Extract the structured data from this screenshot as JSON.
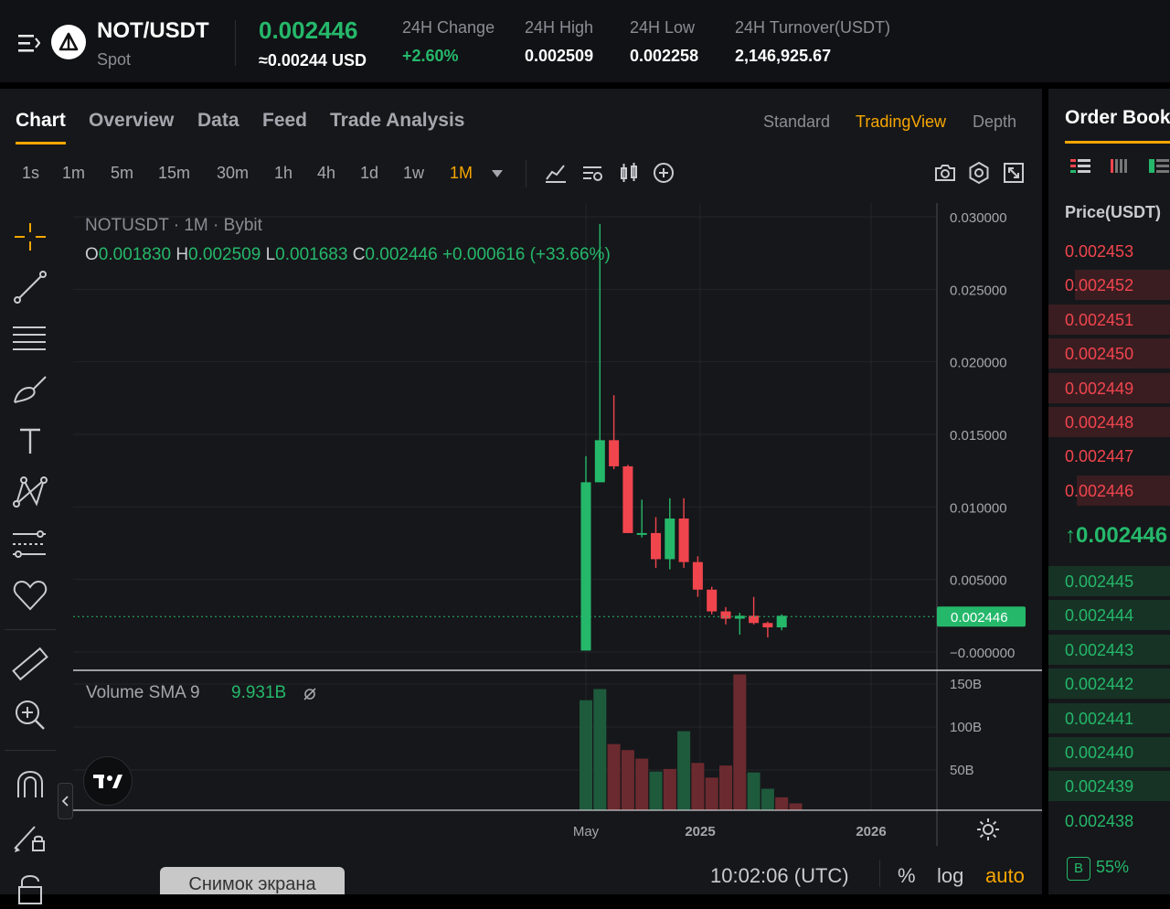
{
  "header": {
    "pair": "NOT/USDT",
    "market": "Spot",
    "last_price": "0.002446",
    "usd_price": "≈0.00244 USD",
    "stats": [
      {
        "label": "24H Change",
        "value": "+2.60%",
        "positive": true
      },
      {
        "label": "24H High",
        "value": "0.002509"
      },
      {
        "label": "24H Low",
        "value": "0.002258"
      },
      {
        "label": "24H Turnover(USDT)",
        "value": "2,146,925.67"
      }
    ]
  },
  "tabs": [
    "Chart",
    "Overview",
    "Data",
    "Feed",
    "Trade Analysis"
  ],
  "active_tab": "Chart",
  "chart_views": [
    "Standard",
    "TradingView",
    "Depth"
  ],
  "active_view": "TradingView",
  "timeframes": [
    "1s",
    "1m",
    "5m",
    "15m",
    "30m",
    "1h",
    "4h",
    "1d",
    "1w",
    "1M"
  ],
  "active_timeframe": "1M",
  "toolbar_icons": [
    "indicators-icon",
    "chart-settings-icon",
    "candle-type-icon",
    "add-compare-icon"
  ],
  "right_icons": [
    "camera-icon",
    "settings-icon",
    "fullscreen-icon"
  ],
  "left_tools": [
    "crosshair-icon",
    "trend-line-icon",
    "fib-retracement-icon",
    "brush-icon",
    "text-icon",
    "pattern-icon",
    "forecast-icon",
    "heart-icon",
    "ruler-icon",
    "zoom-in-icon",
    "magnet-icon",
    "lock-drawing-icon",
    "lock-icon"
  ],
  "legend": {
    "symbol_line": "NOTUSDT · 1M · Bybit",
    "o_label": "O",
    "o": "0.001830",
    "h_label": "H",
    "h": "0.002509",
    "l_label": "L",
    "l": "0.001683",
    "c_label": "C",
    "c": "0.002446",
    "change": "+0.000616 (+33.66%)"
  },
  "volume_indicator": {
    "label": "Volume SMA 9",
    "value": "9.931B",
    "icon": "hide-icon"
  },
  "chart_data": {
    "type": "candlestick",
    "price_ticks": [
      "0.030000",
      "0.025000",
      "0.020000",
      "0.015000",
      "0.010000",
      "0.005000",
      "−0.000000"
    ],
    "last_price_label": "0.002446",
    "volume_ticks": [
      "150B",
      "100B",
      "50B"
    ],
    "x_ticks": [
      "May",
      "2025",
      "2026"
    ],
    "candles": [
      {
        "o": 0.0001,
        "h": 0.0135,
        "l": 0.0001,
        "c": 0.0117
      },
      {
        "o": 0.0117,
        "h": 0.0295,
        "l": 0.0117,
        "c": 0.0146
      },
      {
        "o": 0.0146,
        "h": 0.0177,
        "l": 0.0126,
        "c": 0.0128
      },
      {
        "o": 0.0128,
        "h": 0.0129,
        "l": 0.0082,
        "c": 0.0082
      },
      {
        "o": 0.0082,
        "h": 0.0105,
        "l": 0.0079,
        "c": 0.0082
      },
      {
        "o": 0.0082,
        "h": 0.0093,
        "l": 0.0058,
        "c": 0.0064
      },
      {
        "o": 0.0064,
        "h": 0.0106,
        "l": 0.0057,
        "c": 0.0092
      },
      {
        "o": 0.0092,
        "h": 0.0106,
        "l": 0.0058,
        "c": 0.0062
      },
      {
        "o": 0.0062,
        "h": 0.0066,
        "l": 0.0038,
        "c": 0.0043
      },
      {
        "o": 0.0043,
        "h": 0.0045,
        "l": 0.0026,
        "c": 0.0028
      },
      {
        "o": 0.0028,
        "h": 0.0031,
        "l": 0.0019,
        "c": 0.0023
      },
      {
        "o": 0.0023,
        "h": 0.0027,
        "l": 0.0012,
        "c": 0.0025
      },
      {
        "o": 0.0025,
        "h": 0.0038,
        "l": 0.0019,
        "c": 0.002
      },
      {
        "o": 0.002,
        "h": 0.0021,
        "l": 0.001,
        "c": 0.0017
      },
      {
        "o": 0.0017,
        "h": 0.0026,
        "l": 0.0015,
        "c": 0.0025
      }
    ],
    "volumes": [
      128,
      141,
      77,
      70,
      60,
      45,
      48,
      92,
      55,
      38,
      52,
      158,
      44,
      25,
      15,
      8
    ],
    "volume_up": [
      true,
      true,
      false,
      false,
      false,
      true,
      false,
      true,
      false,
      false,
      false,
      false,
      true,
      true,
      false,
      false
    ],
    "colors": {
      "up": "#25b86b",
      "down": "#f1454e",
      "vol_up": "#1e5a3c",
      "vol_down": "#6b2a2f"
    }
  },
  "status_bar": {
    "time": "10:02:06 (UTC)",
    "percent": "%",
    "log": "log",
    "auto": "auto"
  },
  "screenshot_tooltip": "Снимок экрана",
  "order_book": {
    "title": "Order Book",
    "price_header": "Price(USDT)",
    "view_icons": [
      "orderbook-both-icon",
      "orderbook-bids-icon",
      "orderbook-asks-icon"
    ],
    "asks": [
      {
        "price": "0.002453",
        "depth": 0.0
      },
      {
        "price": "0.002452",
        "depth": 0.78
      },
      {
        "price": "0.002451",
        "depth": 1.0
      },
      {
        "price": "0.002450",
        "depth": 1.0
      },
      {
        "price": "0.002449",
        "depth": 1.0
      },
      {
        "price": "0.002448",
        "depth": 1.0
      },
      {
        "price": "0.002447",
        "depth": 0.0
      },
      {
        "price": "0.002446",
        "depth": 0.77
      }
    ],
    "mid_price": "0.002446",
    "bids": [
      {
        "price": "0.002445",
        "depth": 1.0
      },
      {
        "price": "0.002444",
        "depth": 1.0
      },
      {
        "price": "0.002443",
        "depth": 1.0
      },
      {
        "price": "0.002442",
        "depth": 1.0
      },
      {
        "price": "0.002441",
        "depth": 1.0
      },
      {
        "price": "0.002440",
        "depth": 1.0
      },
      {
        "price": "0.002439",
        "depth": 1.0
      },
      {
        "price": "0.002438",
        "depth": 0.0
      }
    ],
    "buy_ratio_label": "B",
    "buy_ratio": "55%"
  }
}
